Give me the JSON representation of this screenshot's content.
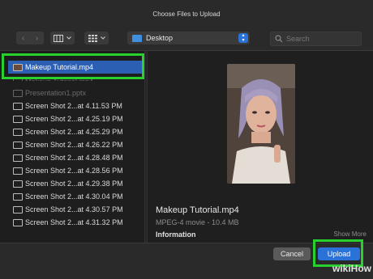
{
  "dialog": {
    "title": "Choose Files to Upload"
  },
  "toolbar": {
    "back_glyph": "‹",
    "forward_glyph": "›",
    "view_columns_icon": "columns-icon",
    "view_grid_icon": "grid-icon",
    "location": "Desktop",
    "search_placeholder": "Search"
  },
  "files": [
    {
      "name": "Makeup Tutorial.mp4",
      "icon": "video-file-icon",
      "selected": true
    },
    {
      "name": "Makeup Tutorial.mp4",
      "icon": "video-file-icon",
      "dim": true
    },
    {
      "name": "Presentation1.pptx",
      "icon": "document-icon",
      "dim": true
    },
    {
      "name": "Screen Shot 2...at 4.11.53 PM",
      "icon": "image-file-icon"
    },
    {
      "name": "Screen Shot 2...at 4.25.19 PM",
      "icon": "image-file-icon"
    },
    {
      "name": "Screen Shot 2...at 4.25.29 PM",
      "icon": "image-file-icon"
    },
    {
      "name": "Screen Shot 2...at 4.26.22 PM",
      "icon": "image-file-icon"
    },
    {
      "name": "Screen Shot 2...at 4.28.48 PM",
      "icon": "image-file-icon"
    },
    {
      "name": "Screen Shot 2...at 4.28.56 PM",
      "icon": "image-file-icon"
    },
    {
      "name": "Screen Shot 2...at 4.29.38 PM",
      "icon": "image-file-icon"
    },
    {
      "name": "Screen Shot 2...at 4.30.04 PM",
      "icon": "image-file-icon"
    },
    {
      "name": "Screen Shot 2...at 4.30.57 PM",
      "icon": "image-file-icon"
    },
    {
      "name": "Screen Shot 2...at 4.31.32 PM",
      "icon": "image-file-icon"
    }
  ],
  "preview": {
    "name": "Makeup Tutorial.mp4",
    "meta": "MPEG-4 movie - 10.4 MB",
    "info_heading": "Information",
    "show_more": "Show More"
  },
  "footer": {
    "cancel_label": "Cancel",
    "upload_label": "Upload"
  },
  "watermark": "wikiHow",
  "colors": {
    "accent": "#2b72d8",
    "selection": "#2b5fb3",
    "highlight": "#29d12f"
  }
}
